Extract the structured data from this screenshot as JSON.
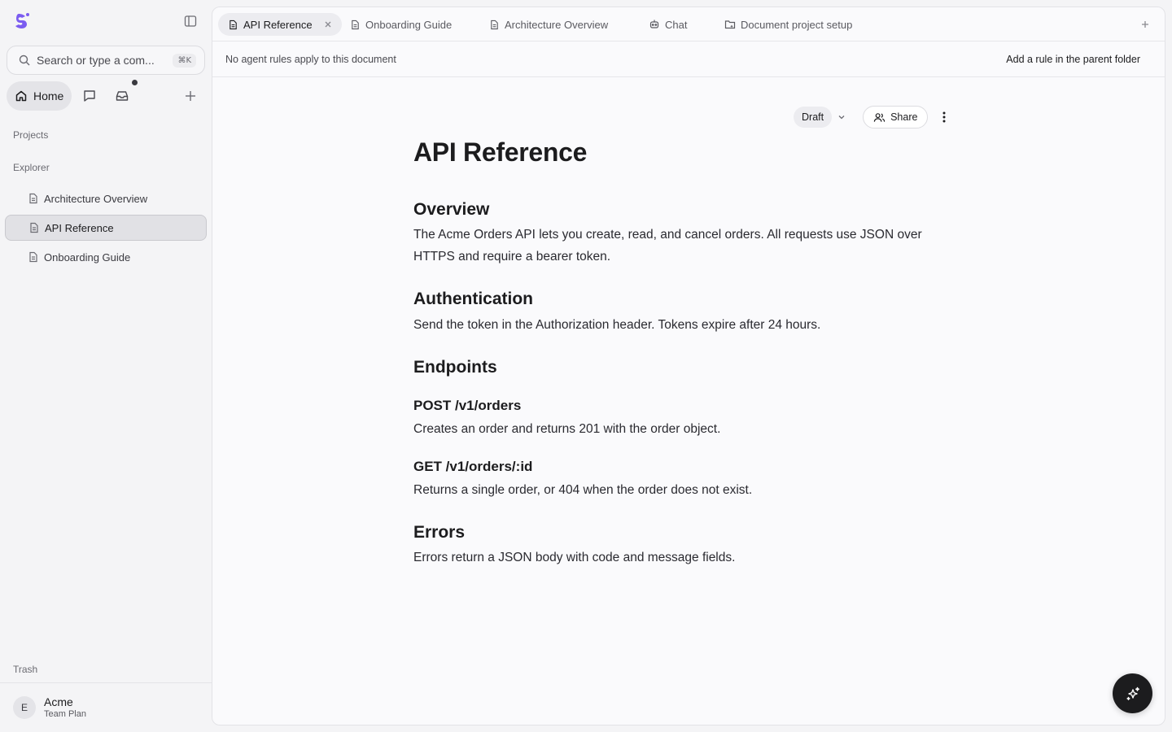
{
  "sidebar": {
    "search_placeholder": "Search or type a com...",
    "search_shortcut": "⌘K",
    "home_label": "Home",
    "projects_label": "Projects",
    "explorer_label": "Explorer",
    "items": [
      {
        "label": "Architecture Overview",
        "active": false
      },
      {
        "label": "API Reference",
        "active": true
      },
      {
        "label": "Onboarding Guide",
        "active": false
      }
    ],
    "trash_label": "Trash",
    "account": {
      "initial": "E",
      "name": "Acme",
      "plan": "Team Plan"
    }
  },
  "tabs": [
    {
      "label": "API Reference",
      "icon": "document-icon",
      "active": true
    },
    {
      "label": "Onboarding Guide",
      "icon": "document-icon",
      "active": false
    },
    {
      "label": "Architecture Overview",
      "icon": "document-icon",
      "active": false
    },
    {
      "label": "Chat",
      "icon": "bot-icon",
      "active": false
    },
    {
      "label": "Document project setup",
      "icon": "folder-sparkle-icon",
      "active": false
    }
  ],
  "rules": {
    "message": "No agent rules apply to this document",
    "action": "Add a rule in the parent folder"
  },
  "doc_actions": {
    "status": "Draft",
    "share_label": "Share"
  },
  "document": {
    "title": "API Reference",
    "overview_heading": "Overview",
    "overview_text": "The Acme Orders API lets you create, read, and cancel orders. All requests use JSON over HTTPS and require a bearer token.",
    "auth_heading": "Authentication",
    "auth_text": "Send the token in the Authorization header. Tokens expire after 24 hours.",
    "endpoints_heading": "Endpoints",
    "post_heading": "POST /v1/orders",
    "post_text": "Creates an order and returns 201 with the order object.",
    "get_heading": "GET /v1/orders/:id",
    "get_text": "Returns a single order, or 404 when the order does not exist.",
    "errors_heading": "Errors",
    "errors_text": "Errors return a JSON body with code and message fields."
  },
  "colors": {
    "accent": "#7b5cf0",
    "fab": "#1c1c1e"
  }
}
